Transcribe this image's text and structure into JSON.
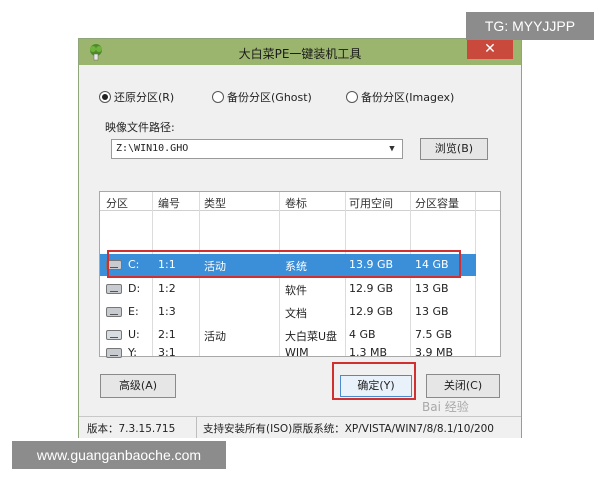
{
  "window": {
    "title": "大白菜PE一键装机工具",
    "close_glyph": "✕"
  },
  "modes": [
    {
      "label": "还原分区(R)",
      "checked": true
    },
    {
      "label": "备份分区(Ghost)",
      "checked": false
    },
    {
      "label": "备份分区(Imagex)",
      "checked": false
    }
  ],
  "image_path": {
    "label": "映像文件路径:",
    "value": "Z:\\WIN10.GHO",
    "browse_label": "浏览(B)"
  },
  "table": {
    "headers": [
      "分区",
      "编号",
      "类型",
      "卷标",
      "可用空间",
      "分区容量"
    ],
    "rows": [
      {
        "drive": "C:",
        "num": "1:1",
        "type": "活动",
        "label": "系统",
        "free": "13.9 GB",
        "size": "14 GB",
        "icon": "hard-drive-icon"
      },
      {
        "drive": "D:",
        "num": "1:2",
        "type": "",
        "label": "软件",
        "free": "12.9 GB",
        "size": "13 GB",
        "icon": "hard-drive-icon"
      },
      {
        "drive": "E:",
        "num": "1:3",
        "type": "",
        "label": "文档",
        "free": "12.9 GB",
        "size": "13 GB",
        "icon": "hard-drive-icon"
      },
      {
        "drive": "U:",
        "num": "2:1",
        "type": "活动",
        "label": "大白菜U盘",
        "free": "4 GB",
        "size": "7.5 GB",
        "icon": "usb-drive-icon"
      },
      {
        "drive": "Y:",
        "num": "3:1",
        "type": "",
        "label": "WIM",
        "free": "1.3 MB",
        "size": "3.9 MB",
        "icon": "hard-drive-icon"
      }
    ]
  },
  "buttons": {
    "advanced": "高级(A)",
    "ok": "确定(Y)",
    "close": "关闭(C)"
  },
  "status": {
    "version": "版本：7.3.15.715",
    "support": "支持安装所有(ISO)原版系统：XP/VISTA/WIN7/8/8.1/10/200"
  },
  "overlays": {
    "tg": "TG: MYYJJPP",
    "site": "www.guanganbaoche.com",
    "watermark": "Bai 经验"
  },
  "colors": {
    "selection": "#3b8fd8",
    "highlight_box": "#d03030",
    "titlebar": "#9bb56e"
  }
}
